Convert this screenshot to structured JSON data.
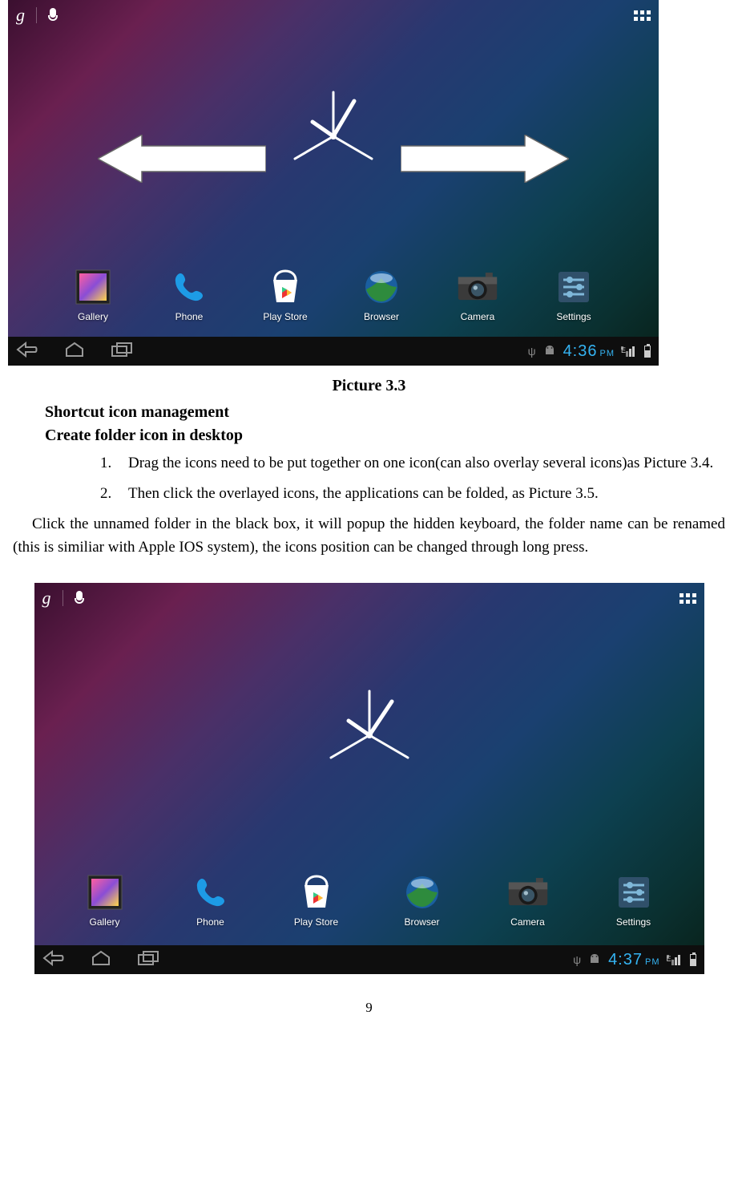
{
  "screenshot_top": {
    "google_label": "g",
    "apps": [
      {
        "name": "Gallery"
      },
      {
        "name": "Phone"
      },
      {
        "name": "Play Store"
      },
      {
        "name": "Browser"
      },
      {
        "name": "Camera"
      },
      {
        "name": "Settings"
      }
    ],
    "time": "4:36",
    "time_suffix": "PM",
    "net_label": "E"
  },
  "caption1": "Picture 3.3",
  "heading1": "Shortcut icon management",
  "heading2": "Create folder icon in desktop",
  "list": [
    "Drag the icons need to be put together on one icon(can also overlay several icons)as Picture 3.4.",
    "Then click the overlayed icons, the applications can be folded, as Picture 3.5."
  ],
  "paragraph": "Click the unnamed folder in the black box, it will popup the hidden keyboard, the folder name can be renamed (this is similiar with Apple IOS system), the icons position can be changed through long press.",
  "screenshot_bottom": {
    "google_label": "g",
    "apps": [
      {
        "name": "Gallery"
      },
      {
        "name": "Phone"
      },
      {
        "name": "Play Store"
      },
      {
        "name": "Browser"
      },
      {
        "name": "Camera"
      },
      {
        "name": "Settings"
      }
    ],
    "time": "4:37",
    "time_suffix": "PM",
    "net_label": "E"
  },
  "page_number": "9"
}
